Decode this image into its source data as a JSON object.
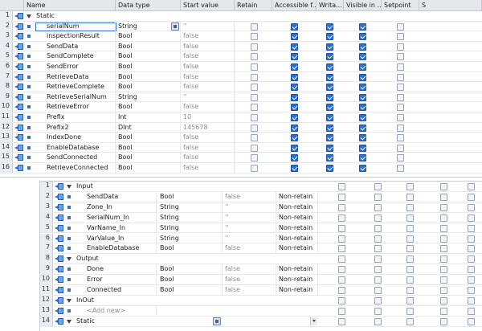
{
  "top": {
    "columns": [
      "Name",
      "Data type",
      "Start value",
      "Retain",
      "Accessible f...",
      "Writa...",
      "Visible in ...",
      "Setpoint",
      "S"
    ],
    "rows": [
      {
        "num": "1",
        "kind": "section",
        "name": "Static",
        "type": "",
        "start": "",
        "retain": null,
        "access": null,
        "write": null,
        "visible": null,
        "setpoint": null
      },
      {
        "num": "2",
        "kind": "item",
        "name": "serialNum",
        "type": "String",
        "start": "''",
        "retain": false,
        "access": true,
        "write": true,
        "visible": true,
        "setpoint": false,
        "editing": true
      },
      {
        "num": "3",
        "kind": "item",
        "name": "inspectionResult",
        "type": "Bool",
        "start": "false",
        "retain": false,
        "access": true,
        "write": true,
        "visible": true,
        "setpoint": false
      },
      {
        "num": "4",
        "kind": "item",
        "name": "SendData",
        "type": "Bool",
        "start": "false",
        "retain": false,
        "access": true,
        "write": true,
        "visible": true,
        "setpoint": false
      },
      {
        "num": "5",
        "kind": "item",
        "name": "SendComplete",
        "type": "Bool",
        "start": "false",
        "retain": false,
        "access": true,
        "write": true,
        "visible": true,
        "setpoint": false
      },
      {
        "num": "6",
        "kind": "item",
        "name": "SendError",
        "type": "Bool",
        "start": "false",
        "retain": false,
        "access": true,
        "write": true,
        "visible": true,
        "setpoint": false
      },
      {
        "num": "7",
        "kind": "item",
        "name": "RetrieveData",
        "type": "Bool",
        "start": "false",
        "retain": false,
        "access": true,
        "write": true,
        "visible": true,
        "setpoint": false
      },
      {
        "num": "8",
        "kind": "item",
        "name": "RetrieveComplete",
        "type": "Bool",
        "start": "false",
        "retain": false,
        "access": true,
        "write": true,
        "visible": true,
        "setpoint": false
      },
      {
        "num": "9",
        "kind": "item",
        "name": "RetrieveSerialNum",
        "type": "String",
        "start": "''",
        "retain": false,
        "access": true,
        "write": true,
        "visible": true,
        "setpoint": false
      },
      {
        "num": "10",
        "kind": "item",
        "name": "RetrieveError",
        "type": "Bool",
        "start": "false",
        "retain": false,
        "access": true,
        "write": true,
        "visible": true,
        "setpoint": false
      },
      {
        "num": "11",
        "kind": "item",
        "name": "Prefix",
        "type": "Int",
        "start": "10",
        "retain": false,
        "access": true,
        "write": true,
        "visible": true,
        "setpoint": false
      },
      {
        "num": "12",
        "kind": "item",
        "name": "Prefix2",
        "type": "DInt",
        "start": "145678",
        "retain": false,
        "access": true,
        "write": true,
        "visible": true,
        "setpoint": false
      },
      {
        "num": "13",
        "kind": "item",
        "name": "IndexDone",
        "type": "Bool",
        "start": "false",
        "retain": false,
        "access": true,
        "write": true,
        "visible": true,
        "setpoint": false
      },
      {
        "num": "14",
        "kind": "item",
        "name": "EnableDatabase",
        "type": "Bool",
        "start": "false",
        "retain": false,
        "access": true,
        "write": true,
        "visible": true,
        "setpoint": false
      },
      {
        "num": "15",
        "kind": "item",
        "name": "SendConnected",
        "type": "Bool",
        "start": "false",
        "retain": false,
        "access": true,
        "write": true,
        "visible": true,
        "setpoint": false
      },
      {
        "num": "16",
        "kind": "item",
        "name": "RetrieveConnected",
        "type": "Bool",
        "start": "false",
        "retain": false,
        "access": true,
        "write": true,
        "visible": true,
        "setpoint": false
      }
    ]
  },
  "bottom": {
    "rows": [
      {
        "num": "1",
        "kind": "section",
        "name": "Input",
        "type": "",
        "start": "",
        "retain": ""
      },
      {
        "num": "2",
        "kind": "item",
        "name": "SendData",
        "type": "Bool",
        "start": "false",
        "retain": "Non-retain"
      },
      {
        "num": "3",
        "kind": "item",
        "name": "Zone_In",
        "type": "String",
        "start": "''",
        "retain": "Non-retain"
      },
      {
        "num": "4",
        "kind": "item",
        "name": "SerialNum_In",
        "type": "String",
        "start": "''",
        "retain": "Non-retain"
      },
      {
        "num": "5",
        "kind": "item",
        "name": "VarName_In",
        "type": "String",
        "start": "''",
        "retain": "Non-retain"
      },
      {
        "num": "6",
        "kind": "item",
        "name": "VarValue_In",
        "type": "String",
        "start": "''",
        "retain": "Non-retain"
      },
      {
        "num": "7",
        "kind": "item",
        "name": "EnableDatabase",
        "type": "Bool",
        "start": "false",
        "retain": "Non-retain"
      },
      {
        "num": "8",
        "kind": "section",
        "name": "Output",
        "type": "",
        "start": "",
        "retain": ""
      },
      {
        "num": "9",
        "kind": "item",
        "name": "Done",
        "type": "Bool",
        "start": "false",
        "retain": "Non-retain"
      },
      {
        "num": "10",
        "kind": "item",
        "name": "Error",
        "type": "Bool",
        "start": "false",
        "retain": "Non-retain"
      },
      {
        "num": "11",
        "kind": "item",
        "name": "Connected",
        "type": "Bool",
        "start": "false",
        "retain": "Non-retain"
      },
      {
        "num": "12",
        "kind": "section",
        "name": "InOut",
        "type": "",
        "start": "",
        "retain": ""
      },
      {
        "num": "13",
        "kind": "add",
        "name": "<Add new>",
        "type": "",
        "start": "",
        "retain": ""
      },
      {
        "num": "14",
        "kind": "section",
        "name": "Static",
        "type": "",
        "start": "",
        "retain": "",
        "picker": true,
        "dropdown": true
      }
    ]
  },
  "colors": {
    "accent": "#2f6fcf",
    "header_bg": "#e4e7ec",
    "rownum_bg": "#e9ecf1"
  }
}
